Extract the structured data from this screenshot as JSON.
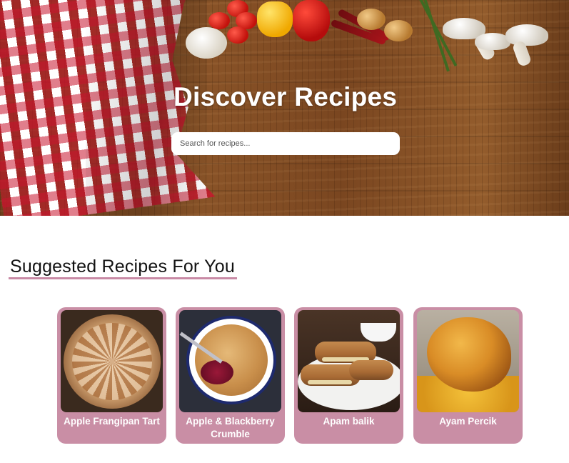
{
  "hero": {
    "title": "Discover Recipes",
    "search_placeholder": "Search for recipes..."
  },
  "section": {
    "title": "Suggested Recipes For You"
  },
  "recipes": [
    {
      "name": "Apple Frangipan Tart"
    },
    {
      "name": "Apple & Blackberry Crumble"
    },
    {
      "name": "Apam balik"
    },
    {
      "name": "Ayam Percik"
    }
  ],
  "colors": {
    "card_background": "#c98ea5",
    "section_underline": "#c98aa5",
    "hero_title": "#ffffff"
  }
}
